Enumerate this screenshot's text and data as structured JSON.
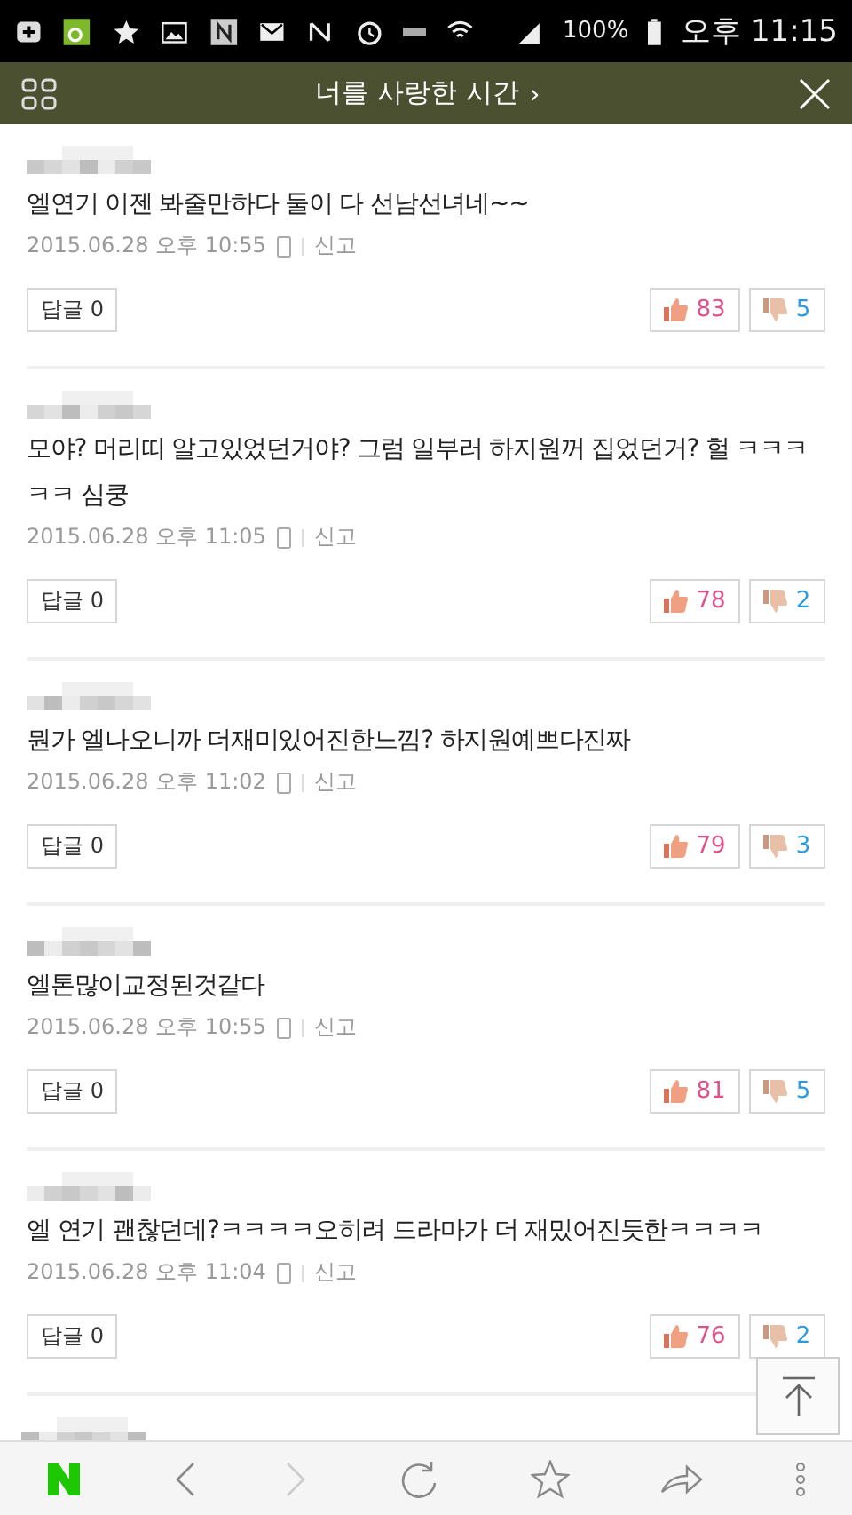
{
  "status_bar": {
    "battery": "100%",
    "time": "오후 11:15"
  },
  "header": {
    "title": "너를 사랑한 시간",
    "title_arrow": "›"
  },
  "comments": [
    {
      "text": "엘연기 이젠 봐줄만하다 둘이 다 선남선녀네~~",
      "date": "2015.06.28 오후 10:55",
      "report": "신고",
      "reply": "답글 0",
      "likes": "83",
      "dislikes": "5"
    },
    {
      "text": "모야? 머리띠 알고있었던거야? 그럼 일부러 하지원꺼 집었던거? 헐 ㅋㅋㅋㅋㅋ 심쿵",
      "date": "2015.06.28 오후 11:05",
      "report": "신고",
      "reply": "답글 0",
      "likes": "78",
      "dislikes": "2"
    },
    {
      "text": "뭔가 엘나오니까 더재미있어진한느낌? 하지원예쁘다진짜",
      "date": "2015.06.28 오후 11:02",
      "report": "신고",
      "reply": "답글 0",
      "likes": "79",
      "dislikes": "3"
    },
    {
      "text": "엘톤많이교정된것같다",
      "date": "2015.06.28 오후 10:55",
      "report": "신고",
      "reply": "답글 0",
      "likes": "81",
      "dislikes": "5"
    },
    {
      "text": "엘 연기 괜찮던데?ㅋㅋㅋㅋ오히려 드라마가 더 재밌어진듯한ㅋㅋㅋㅋ",
      "date": "2015.06.28 오후 11:04",
      "report": "신고",
      "reply": "답글 0",
      "likes": "76",
      "dislikes": "2"
    }
  ]
}
